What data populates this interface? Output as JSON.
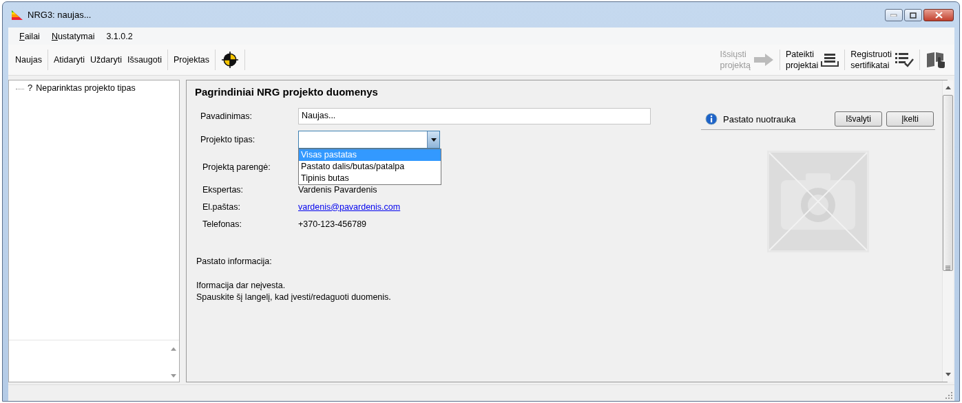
{
  "window": {
    "title": "NRG3:  naujas..."
  },
  "menu": [
    {
      "kind": "menu",
      "label": "Failai"
    },
    {
      "kind": "menu",
      "label": "Nustatymai"
    },
    {
      "kind": "version",
      "label": "3.1.0.2"
    }
  ],
  "toolbar": [
    {
      "kind": "text",
      "label": "Naujas"
    },
    {
      "kind": "separator"
    },
    {
      "kind": "text",
      "label": "Atidaryti"
    },
    {
      "kind": "text",
      "label": "Uždaryti"
    },
    {
      "kind": "text",
      "label": "Išsaugoti"
    },
    {
      "kind": "separator"
    },
    {
      "kind": "text",
      "label": "Projektas"
    },
    {
      "kind": "separator"
    },
    {
      "kind": "icon"
    },
    {
      "kind": "separator"
    }
  ],
  "toolbar_right": [
    {
      "lines": [
        "Išsiųsti",
        "projektą"
      ],
      "disabled": true
    },
    {
      "lines": [
        "Pateikti",
        "projektai"
      ],
      "disabled": false
    },
    {
      "lines": [
        "Registruoti",
        "sertifikatai"
      ],
      "disabled": false
    },
    {
      "disabled": false
    }
  ],
  "tree": [
    {
      "glyph": "?",
      "label": "Neparinktas projekto tipas"
    }
  ],
  "main": {
    "title": "Pagrindiniai NRG projekto duomenys",
    "name_field": {
      "label": "Pavadinimas:",
      "value": "Naujas..."
    },
    "type_field": {
      "label": "Projekto tipas:",
      "expanded": true,
      "options": [
        {
          "label": "Visas pastatas",
          "selected": true
        },
        {
          "label": "Pastato dalis/butas/patalpa",
          "selected": false
        },
        {
          "label": "Tipinis butas",
          "selected": false
        }
      ]
    },
    "author_rows": [
      {
        "label": "Projektą parengė:"
      },
      {
        "kind": "text",
        "label": "Ekspertas:",
        "value": "Vardenis Pavardenis"
      },
      {
        "kind": "link",
        "label": "El.paštas:",
        "value": "vardenis@pavardenis.com"
      },
      {
        "kind": "text",
        "label": "Telefonas:",
        "value": "+370-123-456789"
      }
    ],
    "photo": {
      "title": "Pastato nuotrauka",
      "buttons": [
        "Išvalyti",
        "Įkelti"
      ]
    },
    "info": {
      "label": "Pastato informacija:",
      "lines": [
        "Iformacija dar neįvesta.",
        "Spauskite šį langelį, kad įvesti/redaguoti duomenis."
      ]
    }
  }
}
